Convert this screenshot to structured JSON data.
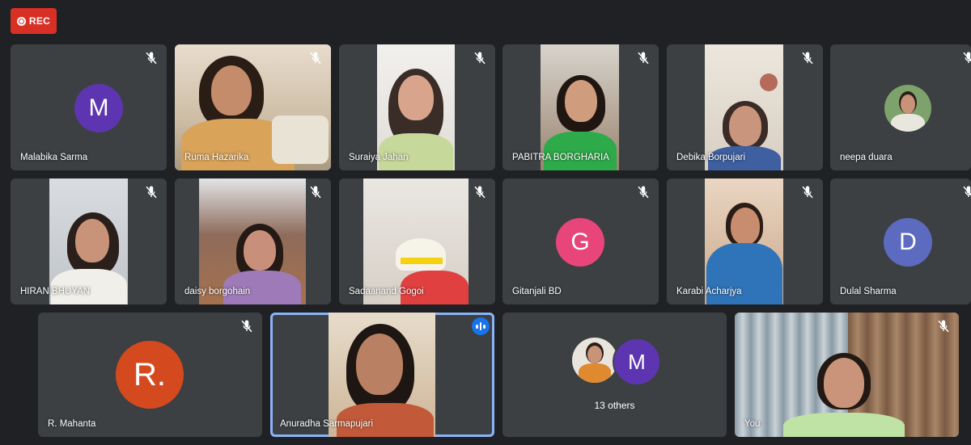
{
  "recording": {
    "label": "REC"
  },
  "participants": [
    {
      "name": "Malabika Sarma",
      "initial": "M",
      "avatar_color": "#5e35b1",
      "muted": true
    },
    {
      "name": "Ruma Hazarika",
      "muted": true
    },
    {
      "name": "Suraiya Jahan",
      "muted": true
    },
    {
      "name": "PABITRA BORGHARIA",
      "muted": true
    },
    {
      "name": "Debika Borpujari",
      "muted": true
    },
    {
      "name": "neepa duara",
      "muted": true
    },
    {
      "name": "HIRAN BHUYAN",
      "muted": true
    },
    {
      "name": "daisy borgohain",
      "muted": true
    },
    {
      "name": "Sadaanand Gogoi",
      "muted": true
    },
    {
      "name": "Gitanjali BD",
      "initial": "G",
      "avatar_color": "#e8457a",
      "muted": true
    },
    {
      "name": "Karabi Acharjya",
      "muted": true
    },
    {
      "name": "Dulal Sharma",
      "initial": "D",
      "avatar_color": "#5c6bc0",
      "muted": true
    },
    {
      "name": "R. Mahanta",
      "initial": "R.",
      "avatar_color": "#d44a1e",
      "muted": true
    },
    {
      "name": "Anuradha Sarmapujari",
      "speaking": true
    },
    {
      "name": "You",
      "muted": true
    }
  ],
  "others": {
    "label": "13 others",
    "initial": "M",
    "avatar_color": "#5e35b1"
  },
  "colors": {
    "background": "#202124",
    "tile": "#3c4043",
    "speaking_outline": "#8ab4f8",
    "rec": "#d93025"
  }
}
